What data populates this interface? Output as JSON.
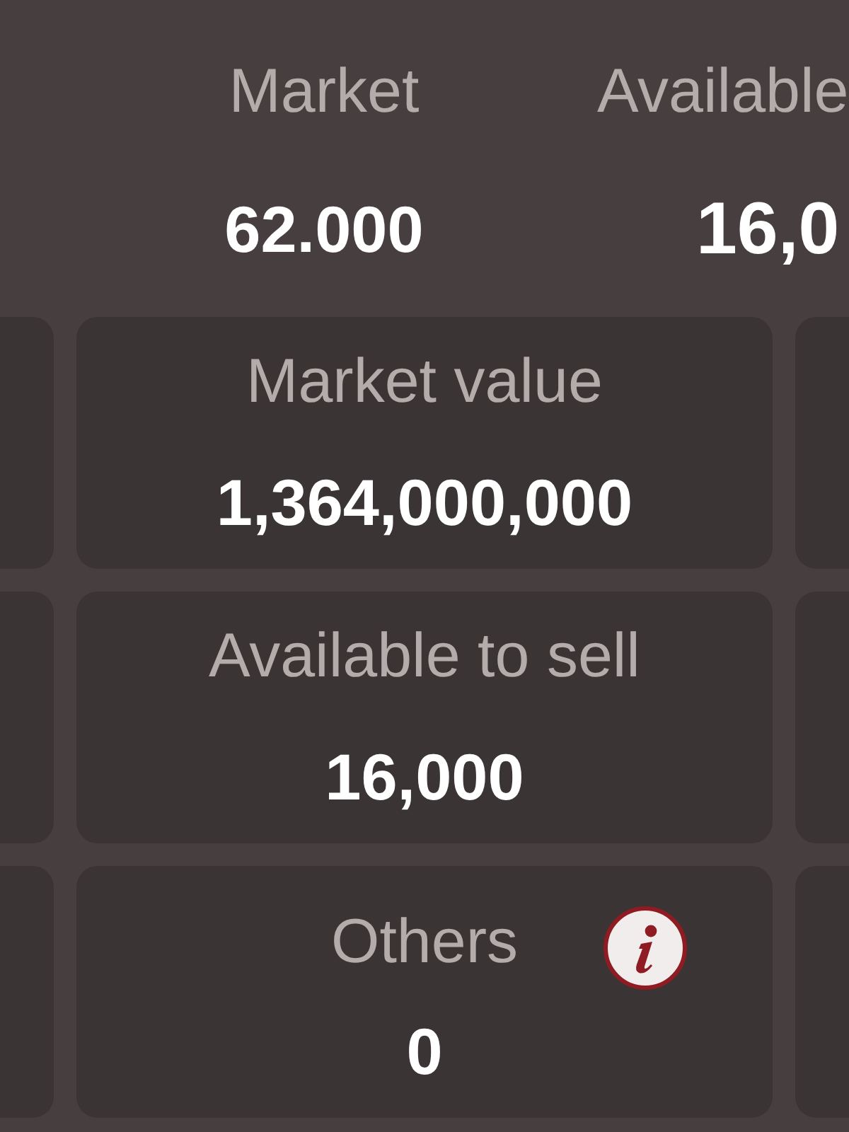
{
  "top_stats": [
    {
      "label": "Market",
      "value": "62.000"
    },
    {
      "label": "Available",
      "value": "16,0"
    }
  ],
  "cards": [
    {
      "label": "Market value",
      "value": "1,364,000,000",
      "info": false
    },
    {
      "label": "Available to sell",
      "value": "16,000",
      "info": false
    },
    {
      "label": "Others",
      "value": "0",
      "info": true
    }
  ]
}
